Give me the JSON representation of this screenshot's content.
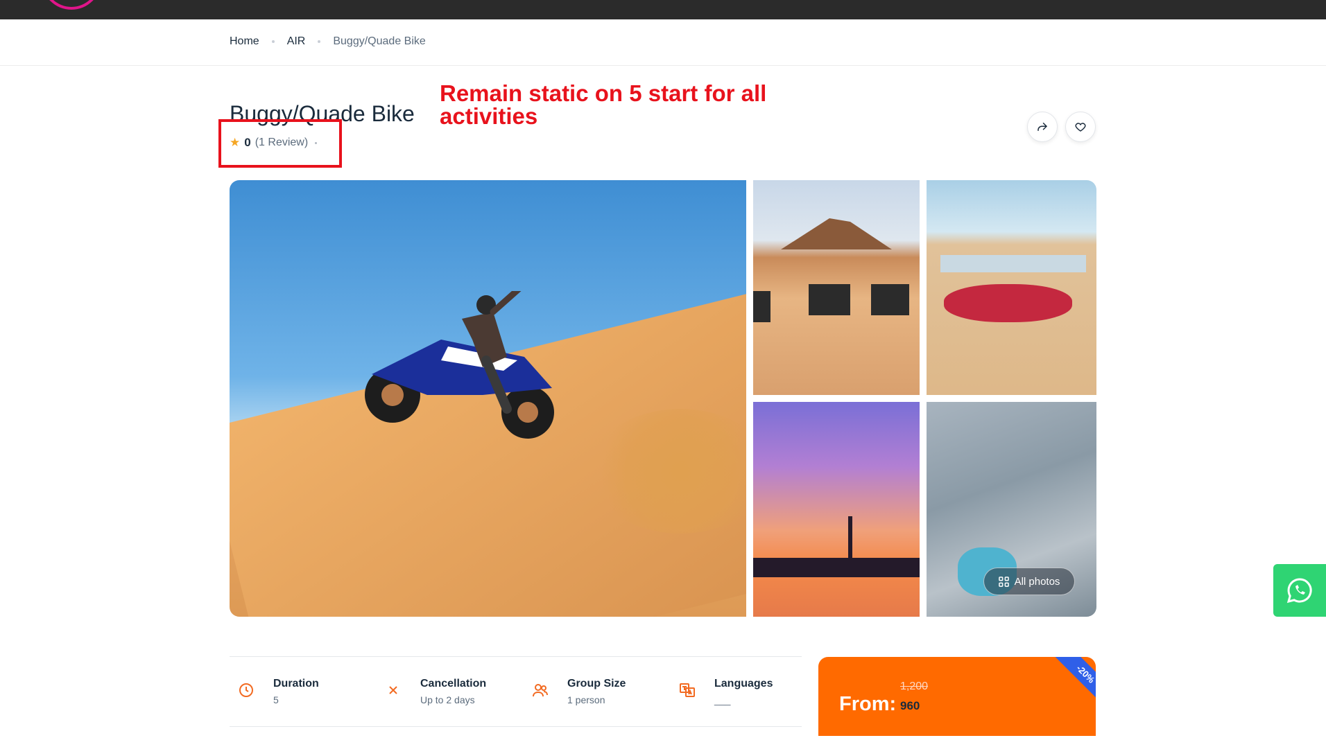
{
  "breadcrumb": {
    "home": "Home",
    "category": "AIR",
    "current": "Buggy/Quade Bike"
  },
  "activity": {
    "title": "Buggy/Quade Bike",
    "rating": "0",
    "reviews": "(1 Review)"
  },
  "annotation": {
    "text": "Remain static on 5 start for all activities",
    "color": "#e8121c"
  },
  "gallery": {
    "images": [
      "quad-bike-on-dune",
      "quad-bikes-desert",
      "desert-camp",
      "dubai-skyline-sunset",
      "dubai-aerial"
    ],
    "all_photos_label": "All photos"
  },
  "facts": [
    {
      "icon": "clock-icon",
      "label": "Duration",
      "value": "5"
    },
    {
      "icon": "close-x-icon",
      "label": "Cancellation",
      "value": "Up to 2 days"
    },
    {
      "icon": "users-icon",
      "label": "Group Size",
      "value": "1 person"
    },
    {
      "icon": "translate-icon",
      "label": "Languages",
      "value": "___"
    }
  ],
  "price": {
    "discount": "-20%",
    "old": "1,200",
    "from_label": "From:",
    "current": "960"
  },
  "colors": {
    "accent": "#ff6a00",
    "ribbon": "#2f5fe8",
    "whatsapp": "#2fd473",
    "star": "#f5a623"
  }
}
